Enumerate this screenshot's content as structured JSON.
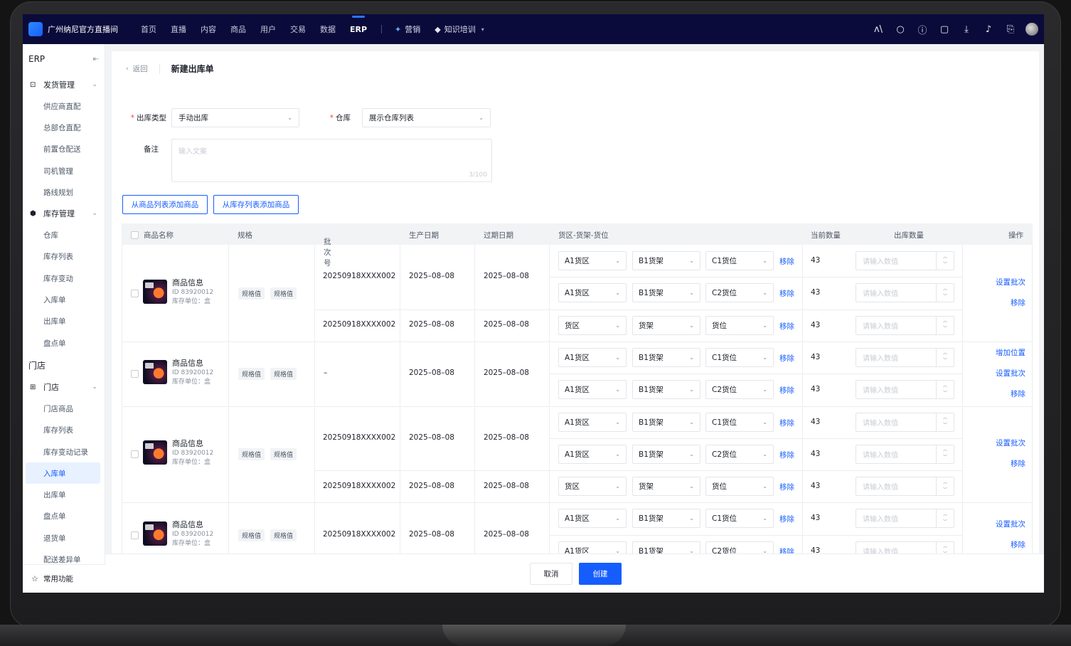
{
  "app": {
    "brand": "广州纳尼官方直播间"
  },
  "nav": {
    "items": [
      "首页",
      "直播",
      "内容",
      "商品",
      "用户",
      "交易",
      "数据",
      "ERP"
    ],
    "active": "ERP",
    "marketing": "营销",
    "training": "知识培训"
  },
  "sidebar": {
    "title": "ERP",
    "group1": "发货管理",
    "group1_items": [
      "供应商直配",
      "总部仓直配",
      "前置仓配送",
      "司机管理",
      "路线规划"
    ],
    "group2": "库存管理",
    "group2_items": [
      "仓库",
      "库存列表",
      "库存变动",
      "入库单",
      "出库单",
      "盘点单"
    ],
    "section_store": "门店",
    "group3": "门店",
    "group3_items": [
      "门店商品",
      "库存列表",
      "库存变动记录",
      "入库单",
      "出库单",
      "盘点单",
      "退货单",
      "配送差异单"
    ],
    "active_item": "入库单",
    "footer": "常用功能"
  },
  "page": {
    "back": "返回",
    "title": "新建出库单",
    "out_type_label": "出库类型",
    "out_type_value": "手动出库",
    "warehouse_label": "仓库",
    "warehouse_value": "展示仓库列表",
    "remark_label": "备注",
    "remark_placeholder": "输入文案",
    "remark_count": "3/100",
    "btn_add_from_goods": "从商品列表添加商品",
    "btn_add_from_stock": "从库存列表添加商品"
  },
  "table": {
    "headers": {
      "name": "商品名称",
      "spec": "规格",
      "batch": "批次号",
      "mfg": "生产日期",
      "exp": "过期日期",
      "location": "货区-货架-货位",
      "current_qty": "当前数量",
      "out_qty": "出库数量",
      "ops": "操作"
    },
    "product": {
      "name": "商品信息",
      "id": "ID 83920012",
      "unit": "库存单位：盒",
      "spec_tag": "规格值"
    },
    "batch_no": "20250918XXXX002",
    "batch_none": "–",
    "date": "2025–08–08",
    "qty": "43",
    "qty_placeholder": "请输入数值",
    "remove": "移除",
    "loc": {
      "zone": "A1货区",
      "shelf": "B1货架",
      "pos1": "C1货位",
      "pos2": "C2货位",
      "zone_empty": "货区",
      "shelf_empty": "货架",
      "pos_empty": "货位"
    },
    "ops": {
      "set_batch": "设置批次",
      "remove": "移除",
      "add_pos": "增加位置"
    }
  },
  "footer": {
    "cancel": "取消",
    "create": "创建"
  },
  "colors": {
    "primary": "#165dff",
    "nav_bg": "#0b0b3b",
    "danger": "#f53f3f"
  }
}
